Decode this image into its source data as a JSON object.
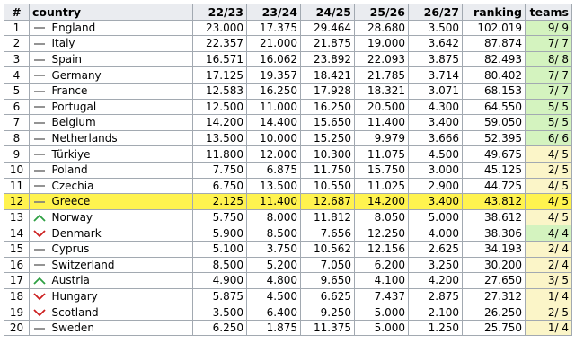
{
  "header": {
    "idx": "#",
    "country": "country",
    "s1": "22/23",
    "s2": "23/24",
    "s3": "24/25",
    "s4": "25/26",
    "s5": "26/27",
    "ranking": "ranking",
    "teams": "teams"
  },
  "colors": {
    "up": "#2ea043",
    "down": "#cc1f1f",
    "same": "#7a7a7a",
    "highlight": "#fff34f"
  },
  "rows": [
    {
      "idx": "1",
      "trend": "same",
      "country": "England",
      "s1": "23.000",
      "s2": "17.375",
      "s3": "29.464",
      "s4": "28.680",
      "s5": "3.500",
      "ranking": "102.019",
      "teams": "9/ 9",
      "tstate": "full"
    },
    {
      "idx": "2",
      "trend": "same",
      "country": "Italy",
      "s1": "22.357",
      "s2": "21.000",
      "s3": "21.875",
      "s4": "19.000",
      "s5": "3.642",
      "ranking": "87.874",
      "teams": "7/ 7",
      "tstate": "full"
    },
    {
      "idx": "3",
      "trend": "same",
      "country": "Spain",
      "s1": "16.571",
      "s2": "16.062",
      "s3": "23.892",
      "s4": "22.093",
      "s5": "3.875",
      "ranking": "82.493",
      "teams": "8/ 8",
      "tstate": "full"
    },
    {
      "idx": "4",
      "trend": "same",
      "country": "Germany",
      "s1": "17.125",
      "s2": "19.357",
      "s3": "18.421",
      "s4": "21.785",
      "s5": "3.714",
      "ranking": "80.402",
      "teams": "7/ 7",
      "tstate": "full"
    },
    {
      "idx": "5",
      "trend": "same",
      "country": "France",
      "s1": "12.583",
      "s2": "16.250",
      "s3": "17.928",
      "s4": "18.321",
      "s5": "3.071",
      "ranking": "68.153",
      "teams": "7/ 7",
      "tstate": "full"
    },
    {
      "idx": "6",
      "trend": "same",
      "country": "Portugal",
      "s1": "12.500",
      "s2": "11.000",
      "s3": "16.250",
      "s4": "20.500",
      "s5": "4.300",
      "ranking": "64.550",
      "teams": "5/ 5",
      "tstate": "full"
    },
    {
      "idx": "7",
      "trend": "same",
      "country": "Belgium",
      "s1": "14.200",
      "s2": "14.400",
      "s3": "15.650",
      "s4": "11.400",
      "s5": "3.400",
      "ranking": "59.050",
      "teams": "5/ 5",
      "tstate": "full"
    },
    {
      "idx": "8",
      "trend": "same",
      "country": "Netherlands",
      "s1": "13.500",
      "s2": "10.000",
      "s3": "15.250",
      "s4": "9.979",
      "s5": "3.666",
      "ranking": "52.395",
      "teams": "6/ 6",
      "tstate": "full"
    },
    {
      "idx": "9",
      "trend": "same",
      "country": "Türkiye",
      "s1": "11.800",
      "s2": "12.000",
      "s3": "10.300",
      "s4": "11.075",
      "s5": "4.500",
      "ranking": "49.675",
      "teams": "4/ 5",
      "tstate": "partial"
    },
    {
      "idx": "10",
      "trend": "same",
      "country": "Poland",
      "s1": "7.750",
      "s2": "6.875",
      "s3": "11.750",
      "s4": "15.750",
      "s5": "3.000",
      "ranking": "45.125",
      "teams": "2/ 5",
      "tstate": "partial"
    },
    {
      "idx": "11",
      "trend": "same",
      "country": "Czechia",
      "s1": "6.750",
      "s2": "13.500",
      "s3": "10.550",
      "s4": "11.025",
      "s5": "2.900",
      "ranking": "44.725",
      "teams": "4/ 5",
      "tstate": "partial"
    },
    {
      "idx": "12",
      "trend": "same",
      "country": "Greece",
      "s1": "2.125",
      "s2": "11.400",
      "s3": "12.687",
      "s4": "14.200",
      "s5": "3.400",
      "ranking": "43.812",
      "teams": "4/ 5",
      "tstate": "partial",
      "highlight": true
    },
    {
      "idx": "13",
      "trend": "up",
      "country": "Norway",
      "s1": "5.750",
      "s2": "8.000",
      "s3": "11.812",
      "s4": "8.050",
      "s5": "5.000",
      "ranking": "38.612",
      "teams": "4/ 5",
      "tstate": "partial"
    },
    {
      "idx": "14",
      "trend": "down",
      "country": "Denmark",
      "s1": "5.900",
      "s2": "8.500",
      "s3": "7.656",
      "s4": "12.250",
      "s5": "4.000",
      "ranking": "38.306",
      "teams": "4/ 4",
      "tstate": "full"
    },
    {
      "idx": "15",
      "trend": "same",
      "country": "Cyprus",
      "s1": "5.100",
      "s2": "3.750",
      "s3": "10.562",
      "s4": "12.156",
      "s5": "2.625",
      "ranking": "34.193",
      "teams": "2/ 4",
      "tstate": "partial"
    },
    {
      "idx": "16",
      "trend": "same",
      "country": "Switzerland",
      "s1": "8.500",
      "s2": "5.200",
      "s3": "7.050",
      "s4": "6.200",
      "s5": "3.250",
      "ranking": "30.200",
      "teams": "2/ 4",
      "tstate": "partial"
    },
    {
      "idx": "17",
      "trend": "up",
      "country": "Austria",
      "s1": "4.900",
      "s2": "4.800",
      "s3": "9.650",
      "s4": "4.100",
      "s5": "4.200",
      "ranking": "27.650",
      "teams": "3/ 5",
      "tstate": "partial"
    },
    {
      "idx": "18",
      "trend": "down",
      "country": "Hungary",
      "s1": "5.875",
      "s2": "4.500",
      "s3": "6.625",
      "s4": "7.437",
      "s5": "2.875",
      "ranking": "27.312",
      "teams": "1/ 4",
      "tstate": "partial"
    },
    {
      "idx": "19",
      "trend": "down",
      "country": "Scotland",
      "s1": "3.500",
      "s2": "6.400",
      "s3": "9.250",
      "s4": "5.000",
      "s5": "2.100",
      "ranking": "26.250",
      "teams": "2/ 5",
      "tstate": "partial"
    },
    {
      "idx": "20",
      "trend": "same",
      "country": "Sweden",
      "s1": "6.250",
      "s2": "1.875",
      "s3": "11.375",
      "s4": "5.000",
      "s5": "1.250",
      "ranking": "25.750",
      "teams": "1/ 4",
      "tstate": "partial"
    }
  ]
}
